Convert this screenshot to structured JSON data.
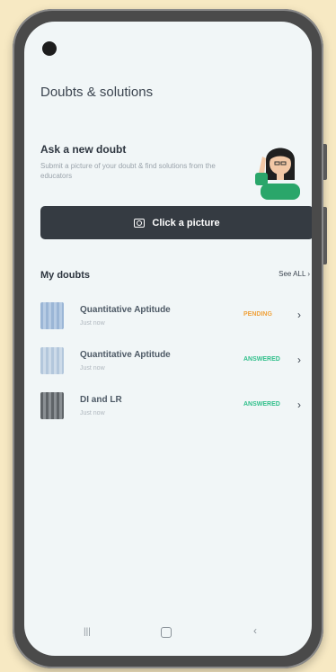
{
  "app": {
    "title": "Doubts & solutions"
  },
  "ask": {
    "title": "Ask a new doubt",
    "subtitle": "Submit a picture of your doubt & find solutions from the educators",
    "button_label": "Click a picture",
    "button_icon": "camera-icon"
  },
  "list": {
    "header": "My doubts",
    "see_all": "See ALL",
    "items": [
      {
        "title": "Quantitative Aptitude",
        "time": "Just now",
        "status": "PENDING",
        "status_color": "#f0a23c",
        "thumb_icon": "document-thumbnail"
      },
      {
        "title": "Quantitative Aptitude",
        "time": "Just now",
        "status": "ANSWERED",
        "status_color": "#2fbf8a",
        "thumb_icon": "document-thumbnail"
      },
      {
        "title": "DI and LR",
        "time": "Just now",
        "status": "ANSWERED",
        "status_color": "#2fbf8a",
        "thumb_icon": "document-thumbnail"
      }
    ]
  },
  "nav": {
    "recents_icon": "recents-icon",
    "home_icon": "home-icon",
    "back_icon": "back-icon"
  },
  "colors": {
    "cta_bg": "#353b42",
    "screen_bg": "#f1f6f7",
    "frame": "#4a4a4a",
    "page_bg": "#f7e9c3"
  }
}
